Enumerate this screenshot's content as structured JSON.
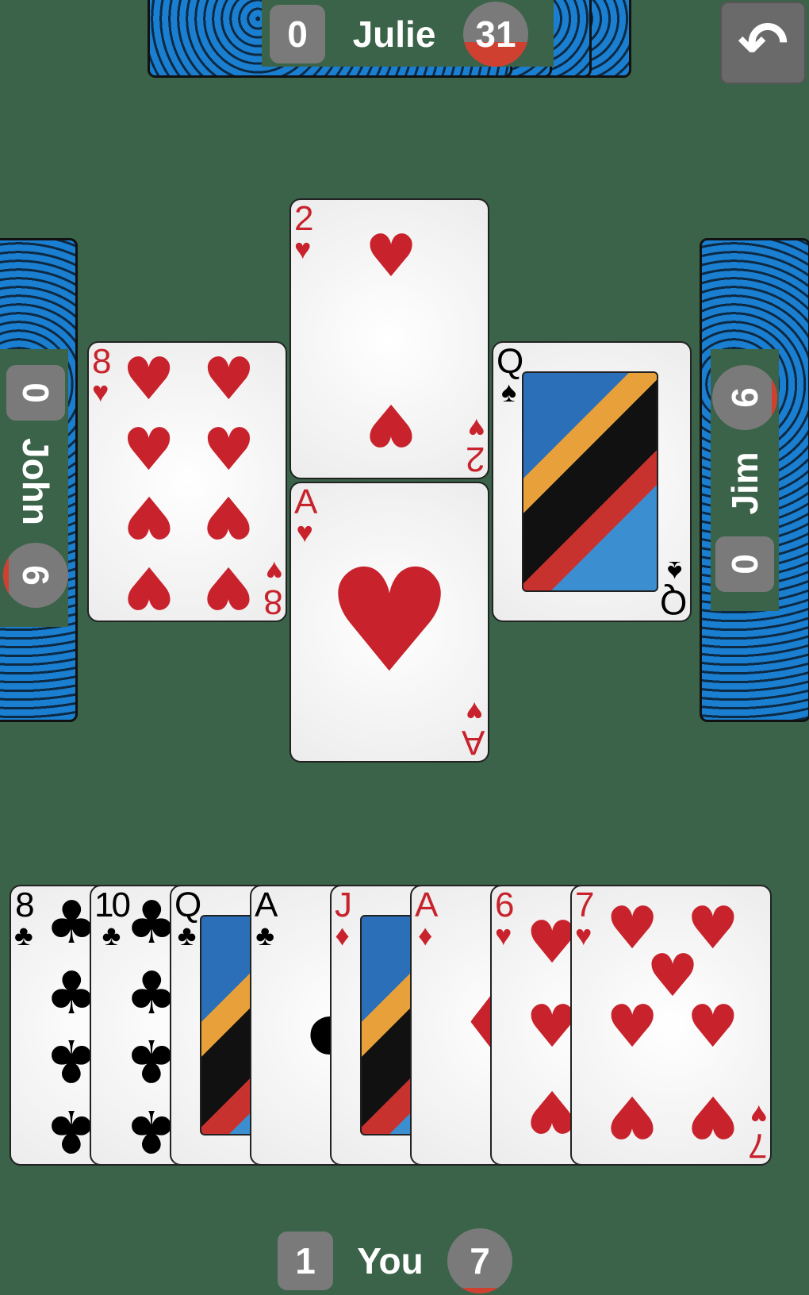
{
  "players": {
    "top": {
      "name": "Julie",
      "tricks": "0",
      "score": "31",
      "score_fill_pct": 38
    },
    "left": {
      "name": "John",
      "tricks": "0",
      "score": "6",
      "score_fill_pct": 8
    },
    "right": {
      "name": "Jim",
      "tricks": "0",
      "score": "6",
      "score_fill_pct": 8
    },
    "bottom": {
      "name": "You",
      "tricks": "1",
      "score": "7",
      "score_fill_pct": 8
    }
  },
  "undo": {
    "icon": "undo-icon",
    "glyph": "↶"
  },
  "trick": [
    {
      "rank": "8",
      "suit": "hearts",
      "player": "left"
    },
    {
      "rank": "2",
      "suit": "hearts",
      "player": "top"
    },
    {
      "rank": "Q",
      "suit": "spades",
      "player": "right"
    },
    {
      "rank": "A",
      "suit": "hearts",
      "player": "bottom"
    }
  ],
  "hand": [
    {
      "rank": "8",
      "suit": "clubs"
    },
    {
      "rank": "10",
      "suit": "clubs"
    },
    {
      "rank": "Q",
      "suit": "clubs"
    },
    {
      "rank": "A",
      "suit": "clubs"
    },
    {
      "rank": "J",
      "suit": "diamonds"
    },
    {
      "rank": "A",
      "suit": "diamonds"
    },
    {
      "rank": "6",
      "suit": "hearts"
    },
    {
      "rank": "7",
      "suit": "hearts"
    }
  ],
  "colors": {
    "table": "#3a6349",
    "card_back": "#1a7fd0",
    "red_suit": "#c8232c",
    "badge": "#7a7a7a",
    "score_fill": "#d04030"
  }
}
